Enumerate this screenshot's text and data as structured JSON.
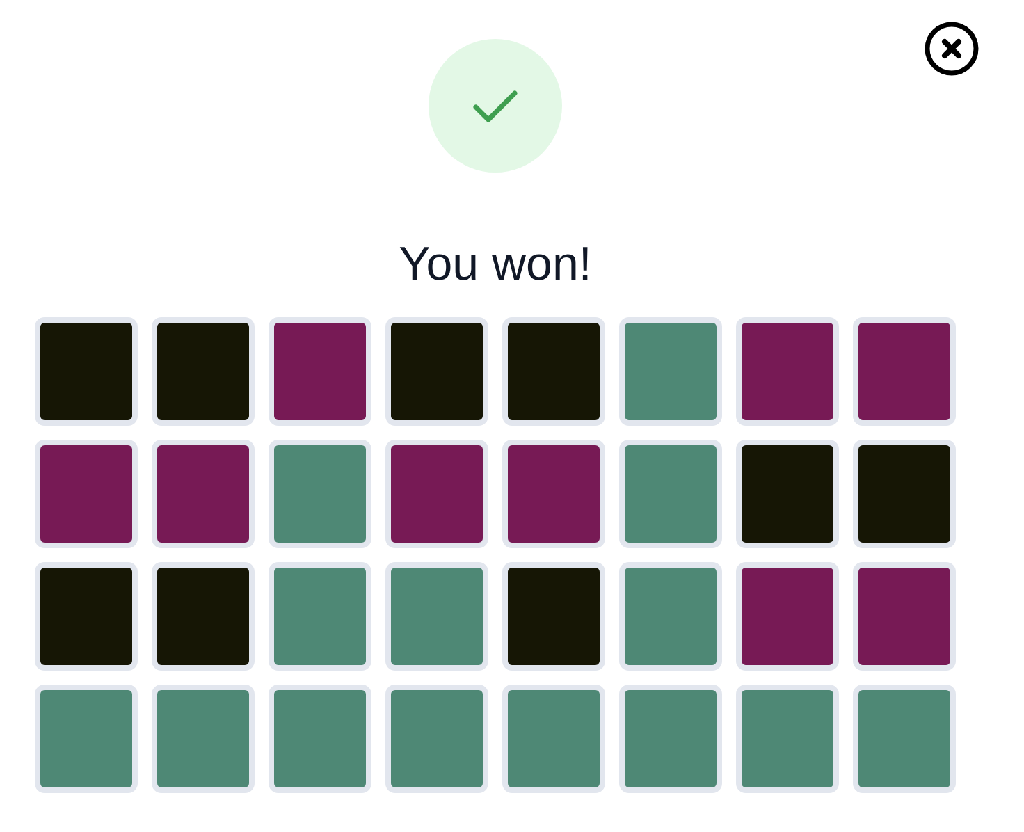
{
  "title": "You won!",
  "tiles": [
    {
      "color": "#161605"
    },
    {
      "color": "#161605"
    },
    {
      "color": "#771a55"
    },
    {
      "color": "#161605"
    },
    {
      "color": "#161605"
    },
    {
      "color": "#4e8875"
    },
    {
      "color": "#771a55"
    },
    {
      "color": "#771a55"
    },
    {
      "color": "#771a55"
    },
    {
      "color": "#771a55"
    },
    {
      "color": "#4e8875"
    },
    {
      "color": "#771a55"
    },
    {
      "color": "#771a55"
    },
    {
      "color": "#4e8875"
    },
    {
      "color": "#161605"
    },
    {
      "color": "#161605"
    },
    {
      "color": "#161605"
    },
    {
      "color": "#161605"
    },
    {
      "color": "#4e8875"
    },
    {
      "color": "#4e8875"
    },
    {
      "color": "#161605"
    },
    {
      "color": "#4e8875"
    },
    {
      "color": "#771a55"
    },
    {
      "color": "#771a55"
    },
    {
      "color": "#4e8875"
    },
    {
      "color": "#4e8875"
    },
    {
      "color": "#4e8875"
    },
    {
      "color": "#4e8875"
    },
    {
      "color": "#4e8875"
    },
    {
      "color": "#4e8875"
    },
    {
      "color": "#4e8875"
    },
    {
      "color": "#4e8875"
    }
  ]
}
